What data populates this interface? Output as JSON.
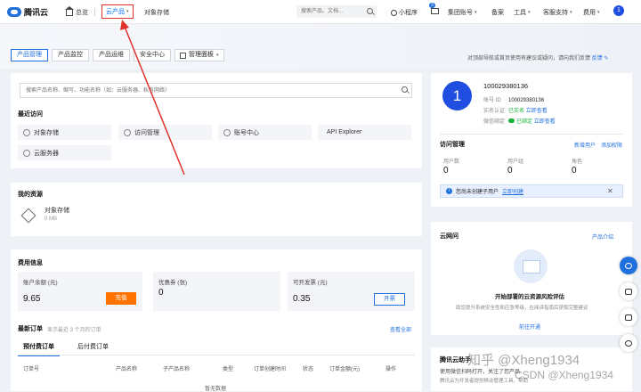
{
  "topbar": {
    "logo": "腾讯云",
    "home": "总览",
    "cloud_products": "云产品",
    "object_storage": "对象存储",
    "search_placeholder": "搜索产品、文档...",
    "mini_program": "小程序",
    "mail_badge": "3",
    "group_account": "集团账号",
    "filing": "备案",
    "tools": "工具",
    "support": "客服支持",
    "billing": "费用",
    "avatar_letter": "1"
  },
  "tabs": [
    "产品管理",
    "产品监控",
    "产品运维",
    "安全中心"
  ],
  "dashboard_label": "管理面板",
  "banner_note": "对顶部导航或首页使用有建议或疑问，请向我们反馈",
  "banner_feedback": "反馈",
  "main_search_placeholder": "搜索产品名称、缩写、功能名称（如：云服务器、私有网络）",
  "recent": {
    "title": "最近访问",
    "items": [
      "对象存储",
      "访问管理",
      "账号中心",
      "API Explorer",
      "云服务器"
    ]
  },
  "resources": {
    "title": "我的资源",
    "name": "对象存储",
    "size": "0 MB"
  },
  "fees": {
    "title": "费用信息",
    "balance_label": "账户余额 (元)",
    "balance": "9.65",
    "recharge": "充值",
    "coupon_label": "优惠券 (张)",
    "coupon": "0",
    "invoice_label": "可开发票 (元)",
    "invoice": "0.35",
    "invoice_btn": "开票"
  },
  "orders": {
    "title": "最新订单",
    "subtitle": "显示最近 3 个月的订单",
    "view_all": "查看全部",
    "tabs": [
      "预付费订单",
      "后付费订单"
    ],
    "columns": [
      "订单号",
      "产品名称",
      "子产品名称",
      "类型",
      "订单创建时间",
      "状态",
      "订单金额(元)",
      "操作"
    ],
    "empty": "暂无数据"
  },
  "profile": {
    "avatar_letter": "1",
    "account_id": "100029380136",
    "fields": [
      {
        "k": "账号 ID",
        "v": "100029380136"
      },
      {
        "k": "实名认证",
        "v": "已实名",
        "link": "立即查看"
      },
      {
        "k": "微信绑定",
        "v": "已绑定",
        "link": "立即查看"
      }
    ]
  },
  "access": {
    "title": "访问管理",
    "new_user": "新增用户",
    "add_permission": "添加权限",
    "stats": [
      {
        "label": "用户数",
        "value": "0"
      },
      {
        "label": "用户组",
        "value": "0"
      },
      {
        "label": "角色",
        "value": "0"
      }
    ],
    "notice": "您尚未创建子用户",
    "notice_link": "立即创建"
  },
  "vpc": {
    "title": "云网问",
    "intro": "产品介绍",
    "heading": "开始部署的云资源风险评估",
    "desc": "助您提升系统安全性和应急等级，在阅读指南后获取完整建议",
    "link": "前往开通"
  },
  "bottom_card": {
    "title": "腾讯云助手",
    "line1": "使用微信扫码打开，关注了您产品",
    "line2": "腾讯云为开发者提供移动管理工具，帮助"
  },
  "watermarks": [
    "知乎 @Xheng1934",
    "CSDN @Xheng1934"
  ],
  "icons": [
    "search-icon",
    "home-icon",
    "mini-program-icon",
    "mail-icon",
    "grid-icon",
    "edit-icon",
    "info-icon",
    "close-icon",
    "headset-icon",
    "chat-icon",
    "book-icon",
    "sync-icon"
  ],
  "colors": {
    "accent": "#1f6fdc",
    "orange": "#ff7200",
    "highlight_red": "#e0322b"
  }
}
